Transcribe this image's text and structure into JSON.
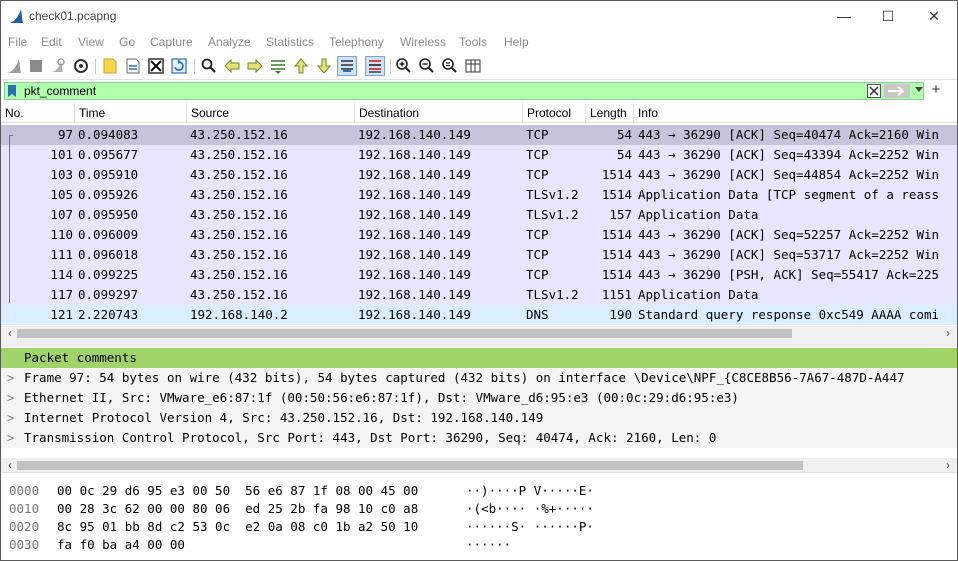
{
  "window": {
    "title": "check01.pcapng",
    "minimize": "—",
    "maximize": "☐",
    "close": "✕"
  },
  "menu": [
    "File",
    "Edit",
    "View",
    "Go",
    "Capture",
    "Analyze",
    "Statistics",
    "Telephony",
    "Wireless",
    "Tools",
    "Help"
  ],
  "toolbar_icons": [
    "shark-fin-start-icon",
    "stop-icon",
    "restart-icon",
    "options-gear-icon",
    "open-folder-icon",
    "save-file-icon",
    "close-file-icon",
    "reload-icon",
    "find-icon",
    "go-back-icon",
    "go-forward-icon",
    "go-to-packet-icon",
    "go-first-icon",
    "go-last-icon",
    "autoscroll-icon",
    "colorize-icon",
    "zoom-in-icon",
    "zoom-out-icon",
    "zoom-reset-icon",
    "resize-columns-icon"
  ],
  "filter": {
    "value": "pkt_comment"
  },
  "packet_list": {
    "columns": [
      "No.",
      "Time",
      "Source",
      "Destination",
      "Protocol",
      "Length",
      "Info"
    ],
    "rows": [
      {
        "no": "97",
        "time": "0.094083",
        "src": "43.250.152.16",
        "dst": "192.168.140.149",
        "proto": "TCP",
        "len": "54",
        "info": "443 → 36290 [ACK] Seq=40474 Ack=2160 Win",
        "bg": "#c6c3da"
      },
      {
        "no": "101",
        "time": "0.095677",
        "src": "43.250.152.16",
        "dst": "192.168.140.149",
        "proto": "TCP",
        "len": "54",
        "info": "443 → 36290 [ACK] Seq=43394 Ack=2252 Win",
        "bg": "#e7e6ff"
      },
      {
        "no": "103",
        "time": "0.095910",
        "src": "43.250.152.16",
        "dst": "192.168.140.149",
        "proto": "TCP",
        "len": "1514",
        "info": "443 → 36290 [ACK] Seq=44854 Ack=2252 Win",
        "bg": "#e7e6ff"
      },
      {
        "no": "105",
        "time": "0.095926",
        "src": "43.250.152.16",
        "dst": "192.168.140.149",
        "proto": "TLSv1.2",
        "len": "1514",
        "info": "Application Data [TCP segment of a reass",
        "bg": "#e7e6ff"
      },
      {
        "no": "107",
        "time": "0.095950",
        "src": "43.250.152.16",
        "dst": "192.168.140.149",
        "proto": "TLSv1.2",
        "len": "157",
        "info": "Application Data",
        "bg": "#e7e6ff"
      },
      {
        "no": "110",
        "time": "0.096009",
        "src": "43.250.152.16",
        "dst": "192.168.140.149",
        "proto": "TCP",
        "len": "1514",
        "info": "443 → 36290 [ACK] Seq=52257 Ack=2252 Win",
        "bg": "#e7e6ff"
      },
      {
        "no": "111",
        "time": "0.096018",
        "src": "43.250.152.16",
        "dst": "192.168.140.149",
        "proto": "TCP",
        "len": "1514",
        "info": "443 → 36290 [ACK] Seq=53717 Ack=2252 Win",
        "bg": "#e7e6ff"
      },
      {
        "no": "114",
        "time": "0.099225",
        "src": "43.250.152.16",
        "dst": "192.168.140.149",
        "proto": "TCP",
        "len": "1514",
        "info": "443 → 36290 [PSH, ACK] Seq=55417 Ack=225",
        "bg": "#e7e6ff"
      },
      {
        "no": "117",
        "time": "0.099297",
        "src": "43.250.152.16",
        "dst": "192.168.140.149",
        "proto": "TLSv1.2",
        "len": "1151",
        "info": "Application Data",
        "bg": "#e7e6ff"
      },
      {
        "no": "121",
        "time": "2.220743",
        "src": "192.168.140.2",
        "dst": "192.168.140.149",
        "proto": "DNS",
        "len": "190",
        "info": "Standard query response 0xc549 AAAA comi",
        "bg": "#daeeff"
      }
    ]
  },
  "details": [
    {
      "text": "Packet comments",
      "bg": "#a0d468",
      "chev": ""
    },
    {
      "text": "Frame 97: 54 bytes on wire (432 bits), 54 bytes captured (432 bits) on interface \\Device\\NPF_{C8CE8B56-7A67-487D-A447",
      "bg": "#f5f5f5",
      "chev": ">"
    },
    {
      "text": "Ethernet II, Src: VMware_e6:87:1f (00:50:56:e6:87:1f), Dst: VMware_d6:95:e3 (00:0c:29:d6:95:e3)",
      "bg": "#f5f5f5",
      "chev": ">"
    },
    {
      "text": "Internet Protocol Version 4, Src: 43.250.152.16, Dst: 192.168.140.149",
      "bg": "#f5f5f5",
      "chev": ">"
    },
    {
      "text": "Transmission Control Protocol, Src Port: 443, Dst Port: 36290, Seq: 40474, Ack: 2160, Len: 0",
      "bg": "#f5f5f5",
      "chev": ">"
    }
  ],
  "bytes": [
    {
      "offset": "0000",
      "hex": "00 0c 29 d6 95 e3 00 50  56 e6 87 1f 08 00 45 00",
      "ascii": "··)····P V·····E·"
    },
    {
      "offset": "0010",
      "hex": "00 28 3c 62 00 00 80 06  ed 25 2b fa 98 10 c0 a8",
      "ascii": "·(<b···· ·%+·····"
    },
    {
      "offset": "0020",
      "hex": "8c 95 01 bb 8d c2 53 0c  e2 0a 08 c0 1b a2 50 10",
      "ascii": "······S· ······P·"
    },
    {
      "offset": "0030",
      "hex": "fa f0 ba a4 00 00",
      "ascii": "······"
    }
  ],
  "colors": {
    "filter_bg": "#afffaf",
    "selected_row": "#c6c3da",
    "tcp_row": "#e7e6ff",
    "dns_row": "#daeeff",
    "comment_header": "#a0d468"
  }
}
